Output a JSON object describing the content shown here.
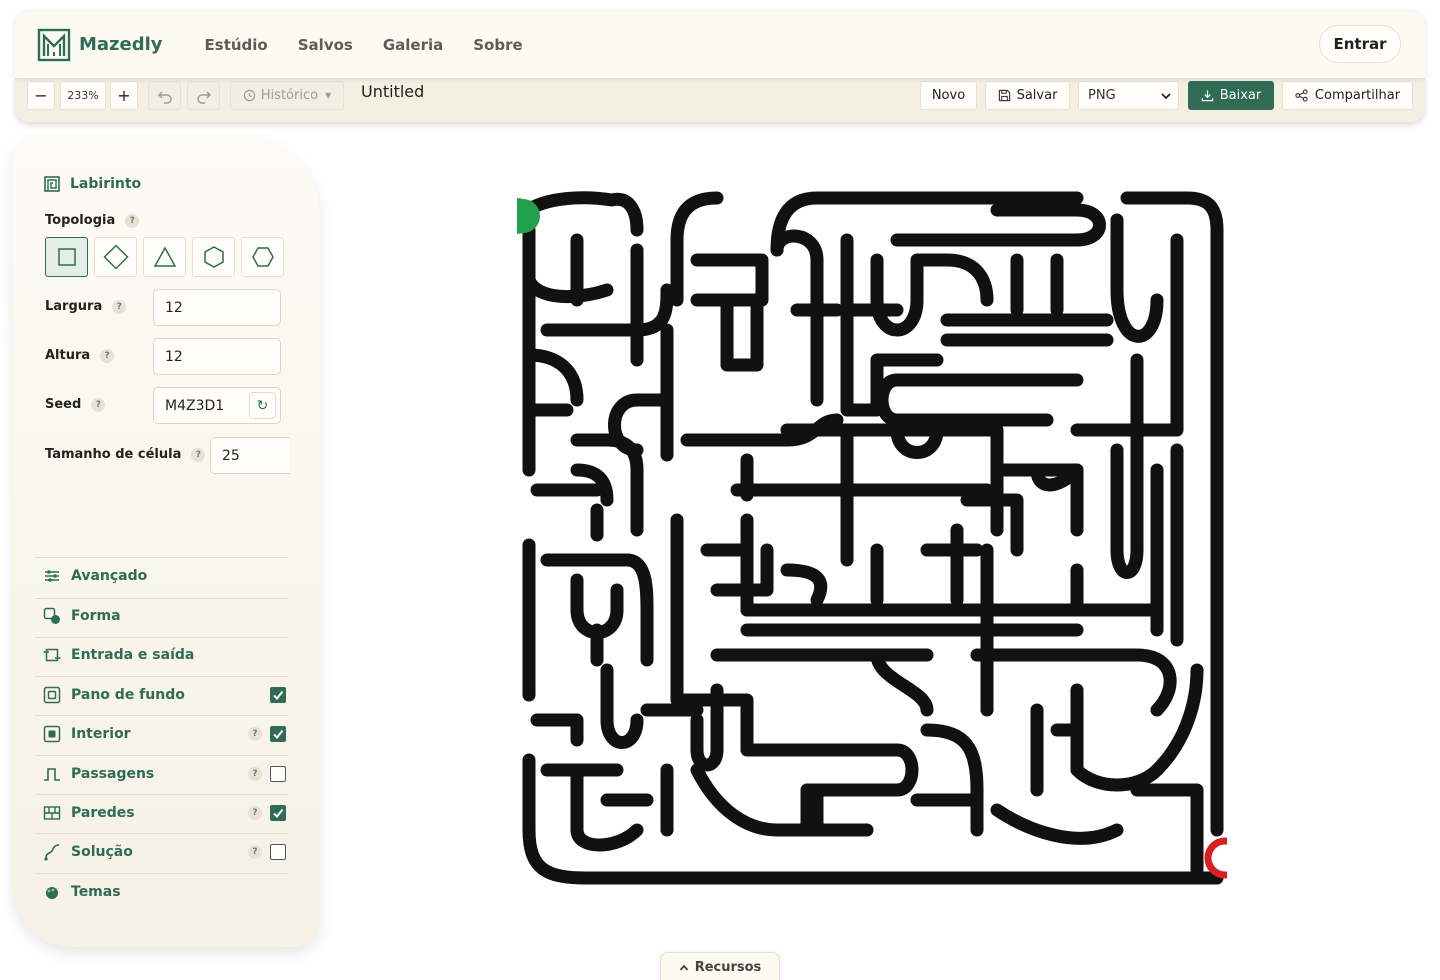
{
  "brand": {
    "name": "Mazedly",
    "icon": "maze-logo-icon",
    "color": "#2f6b55"
  },
  "nav": {
    "items": [
      "Estúdio",
      "Salvos",
      "Galeria",
      "Sobre"
    ]
  },
  "header": {
    "login_label": "Entrar"
  },
  "toolbar": {
    "zoom_minus": "−",
    "zoom_value": "233%",
    "zoom_plus": "+",
    "history_label": "Histórico",
    "document_title": "Untitled",
    "new_label": "Novo",
    "save_label": "Salvar",
    "format_selected": "PNG",
    "download_label": "Baixar",
    "share_label": "Compartilhar"
  },
  "sidebar": {
    "maze_section": {
      "title": "Labirinto",
      "icon": "maze-section-icon"
    },
    "topology": {
      "label": "Topologia",
      "help": "?",
      "options": [
        "square",
        "diamond",
        "triangle",
        "hexagon",
        "octagon"
      ],
      "selected": "square"
    },
    "width": {
      "label": "Largura",
      "help": "?",
      "value": "12"
    },
    "height": {
      "label": "Altura",
      "help": "?",
      "value": "12"
    },
    "seed": {
      "label": "Seed",
      "help": "?",
      "value": "M4Z3D1",
      "refresh_icon": "refresh-icon"
    },
    "cell_size": {
      "label": "Tamanho de célula",
      "help": "?",
      "value": "25"
    },
    "sections": [
      {
        "label": "Avançado",
        "icon": "sliders-icon"
      },
      {
        "label": "Forma",
        "icon": "shape-icon"
      },
      {
        "label": "Entrada e saída",
        "icon": "entry-exit-icon"
      },
      {
        "label": "Pano de fundo",
        "icon": "background-icon",
        "checked": true
      },
      {
        "label": "Interior",
        "icon": "interior-icon",
        "help": "?",
        "checked": true
      },
      {
        "label": "Passagens",
        "icon": "passages-icon",
        "help": "?",
        "checked": false
      },
      {
        "label": "Paredes",
        "icon": "walls-icon",
        "help": "?",
        "checked": true
      },
      {
        "label": "Solução",
        "icon": "solution-icon",
        "help": "?",
        "checked": false
      },
      {
        "label": "Temas",
        "icon": "themes-icon"
      }
    ]
  },
  "maze_colors": {
    "wall": "#111111",
    "start": "#22a04b",
    "end": "#d92020"
  },
  "resources": {
    "label": "Recursos"
  }
}
